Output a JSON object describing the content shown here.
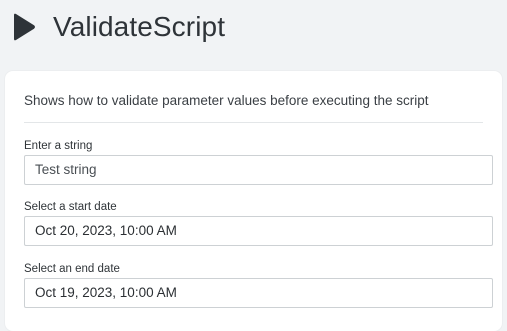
{
  "header": {
    "title": "ValidateScript",
    "icon": "play-icon"
  },
  "card": {
    "description": "Shows how to validate parameter values before executing the script",
    "fields": [
      {
        "label": "Enter a string",
        "value": "Test string"
      },
      {
        "label": "Select a start date",
        "value": "Oct 20, 2023, 10:00 AM"
      },
      {
        "label": "Select an end date",
        "value": "Oct 19, 2023, 10:00 AM"
      }
    ]
  },
  "colors": {
    "background": "#f1f3f5",
    "card": "#ffffff",
    "icon": "#2e3338",
    "border": "#cdd1d4"
  }
}
